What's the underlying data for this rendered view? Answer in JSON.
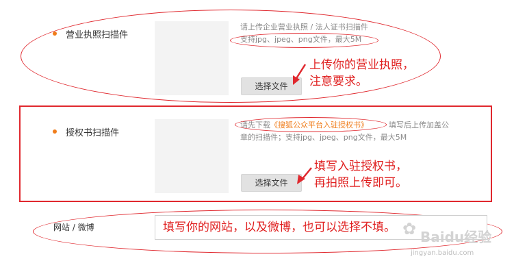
{
  "business_license": {
    "label": "营业执照扫描件",
    "hint_line1": "请上传企业营业执照 / 法人证书扫描件",
    "hint_line2": "支持jpg、jpeg、png文件，最大5M",
    "button": "选择文件",
    "annotation_line1": "上传你的营业执照，",
    "annotation_line2": "注意要求。"
  },
  "authorization_letter": {
    "label": "授权书扫描件",
    "hint_prefix": "请先下载",
    "hint_link": "《搜狐公众平台入驻授权书》",
    "hint_suffix": "填写后上传加盖公",
    "hint_line2": "章的扫描件；支持jpg、jpeg、png文件，最大5M",
    "button": "选择文件",
    "annotation_line1": "填写入驻授权书，",
    "annotation_line2": "再拍照上传即可。"
  },
  "website": {
    "label": "网站 / 微博",
    "input_value": "填写你的网站，以及微博，也可以选择不填。"
  },
  "watermark": {
    "brand": "Baidu经验",
    "url": "jingyan.baidu.com"
  },
  "colors": {
    "accent_orange": "#f07d1b",
    "annotation_red": "#e0282e"
  }
}
